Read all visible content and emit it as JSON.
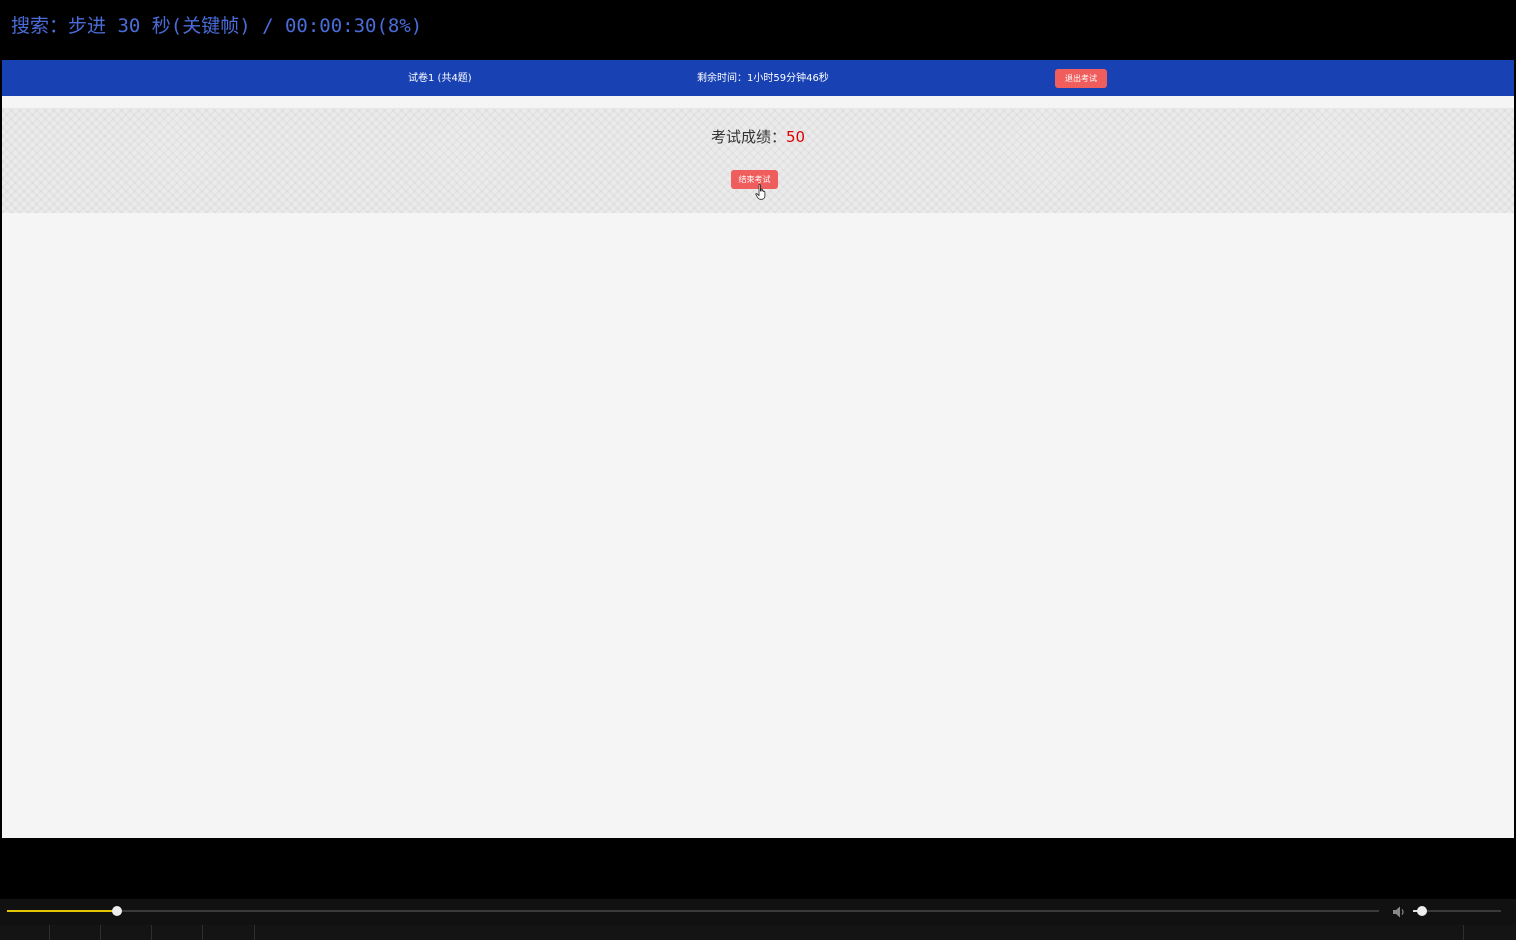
{
  "osd": {
    "text": "搜索：步进 30 秒(关键帧) / 00:00:30(8%)"
  },
  "exam": {
    "title": "试卷1 (共4题)",
    "timer": "剩余时间：1小时59分钟46秒",
    "exit_label": "退出考试",
    "score_label": "考试成绩：",
    "score_value": "50",
    "end_label": "结束考试"
  },
  "player": {
    "progress": 0.08,
    "volume": 0.1,
    "accent_color": "#e5c400"
  },
  "colors": {
    "topbar": "#1842b4",
    "button": "#ef5d5d",
    "score": "#e00000",
    "osd": "#4a6cd9"
  },
  "icons": [
    "hand-cursor-icon",
    "volume-icon"
  ]
}
